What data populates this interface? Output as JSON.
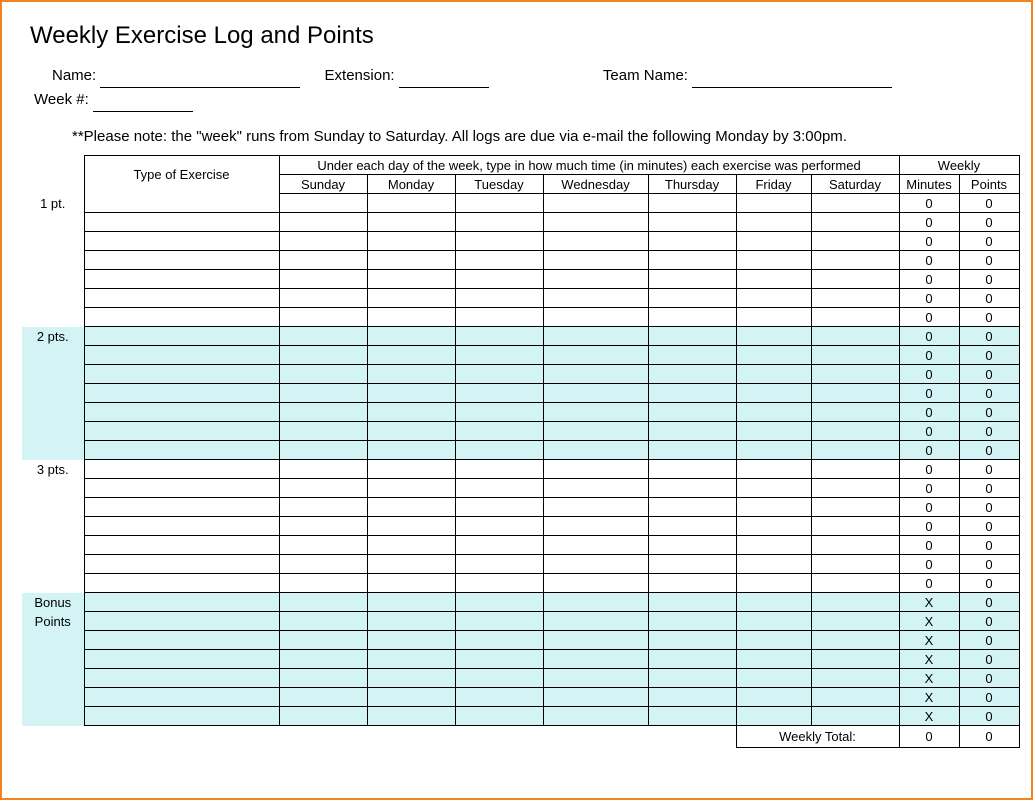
{
  "title": "Weekly Exercise Log and Points",
  "meta": {
    "name_label": "Name:",
    "extension_label": "Extension:",
    "team_label": "Team Name:",
    "week_label": "Week #:"
  },
  "note": "**Please note: the \"week\" runs from Sunday to Saturday.  All logs are due via e-mail the following Monday by 3:00pm.",
  "headers": {
    "type": "Type of Exercise",
    "instruction": "Under each day of the week, type in how much time (in minutes) each exercise was performed",
    "weekly": "Weekly",
    "days": [
      "Sunday",
      "Monday",
      "Tuesday",
      "Wednesday",
      "Thursday",
      "Friday",
      "Saturday"
    ],
    "minutes": "Minutes",
    "points": "Points"
  },
  "sections": [
    {
      "label": "1 pt.",
      "rows": 7,
      "cyan": false,
      "minutes": "0",
      "points": "0"
    },
    {
      "label": "2 pts.",
      "rows": 7,
      "cyan": true,
      "minutes": "0",
      "points": "0"
    },
    {
      "label": "3 pts.",
      "rows": 7,
      "cyan": false,
      "minutes": "0",
      "points": "0"
    },
    {
      "label": "Bonus",
      "label2": "Points",
      "rows": 7,
      "cyan": true,
      "minutes": "X",
      "points": "0"
    }
  ],
  "totals": {
    "label": "Weekly Total:",
    "minutes": "0",
    "points": "0"
  }
}
